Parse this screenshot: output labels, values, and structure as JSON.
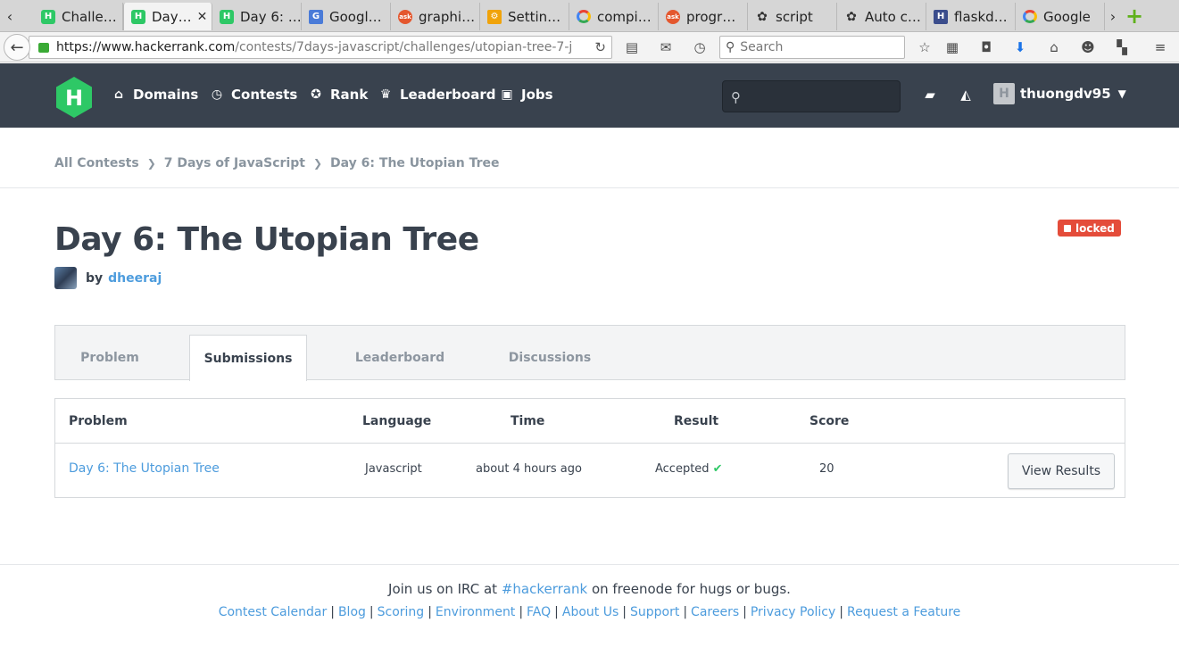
{
  "browser": {
    "tabs": [
      {
        "title": "Challe…",
        "favicon": "hackerrank-icon",
        "active": false
      },
      {
        "title": "Day…",
        "favicon": "hackerrank-icon",
        "active": true
      },
      {
        "title": "Day 6: …",
        "favicon": "hackerrank-icon",
        "active": false
      },
      {
        "title": "Googl…",
        "favicon": "google-translate-icon",
        "active": false
      },
      {
        "title": "graphi…",
        "favicon": "ask-icon",
        "active": false
      },
      {
        "title": "Settin…",
        "favicon": "settings-icon",
        "active": false
      },
      {
        "title": "compi…",
        "favicon": "google-icon",
        "active": false
      },
      {
        "title": "progr…",
        "favicon": "ask-icon",
        "active": false
      },
      {
        "title": "script",
        "favicon": "github-icon",
        "active": false
      },
      {
        "title": "Auto c…",
        "favicon": "github-icon",
        "active": false
      },
      {
        "title": "flaskd…",
        "favicon": "flask-icon",
        "active": false
      },
      {
        "title": "Google",
        "favicon": "google-icon",
        "active": false
      }
    ],
    "url_host": "https://www.hackerrank.com",
    "url_path": "/contests/7days-javascript/challenges/utopian-tree-7-j",
    "search_placeholder": "Search"
  },
  "header": {
    "nav": [
      "Domains",
      "Contests",
      "Rank",
      "Leaderboard",
      "Jobs"
    ],
    "username": "thuongdv95",
    "logo_letter": "H",
    "accent_color": "#2ec866",
    "bg_color": "#39424e"
  },
  "breadcrumb": [
    "All Contests",
    "7 Days of JavaScript",
    "Day 6: The Utopian Tree"
  ],
  "challenge": {
    "title": "Day 6: The Utopian Tree",
    "by_label": "by",
    "author": "dheeraj",
    "status_badge": "locked"
  },
  "tabs": [
    "Problem",
    "Submissions",
    "Leaderboard",
    "Discussions"
  ],
  "submissions": {
    "headers": [
      "Problem",
      "Language",
      "Time",
      "Result",
      "Score"
    ],
    "rows": [
      {
        "problem": "Day 6: The Utopian Tree",
        "language": "Javascript",
        "time": "about 4 hours ago",
        "result": "Accepted",
        "score": "20",
        "action": "View Results"
      }
    ]
  },
  "footer": {
    "irc_prefix": "Join us on IRC at",
    "irc_channel": "#hackerrank",
    "irc_suffix": "on freenode for hugs or bugs.",
    "links": [
      "Contest Calendar",
      "Blog",
      "Scoring",
      "Environment",
      "FAQ",
      "About Us",
      "Support",
      "Careers",
      "Privacy Policy",
      "Request a Feature"
    ]
  }
}
